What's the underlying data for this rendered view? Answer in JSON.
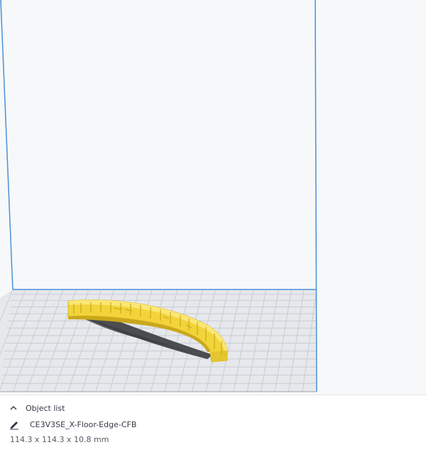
{
  "object_list": {
    "title": "Object list",
    "object_name": "CE3V3SE_X-Floor-Edge-CFB",
    "dimensions": "114.3 x 114.3 x 10.8 mm"
  },
  "colors": {
    "model_fill": "#f2d43a",
    "model_shade": "#c9a81c",
    "build_volume_edge": "#4a90d9",
    "grid_line": "#c8ccd2",
    "plate_fill": "#e6e8eb",
    "shadow": "#4d4f52"
  },
  "icons": {
    "collapse": "chevron-up-icon",
    "edit": "pencil-icon"
  }
}
